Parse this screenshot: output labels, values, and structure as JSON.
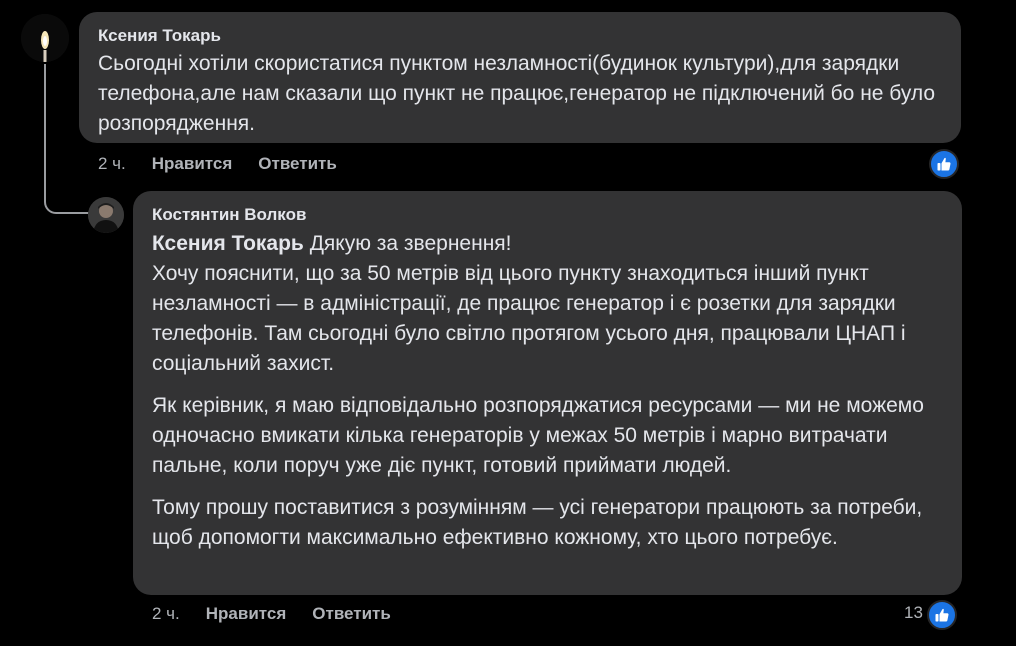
{
  "comments": [
    {
      "author": "Ксения Токарь",
      "text": "Сьогодні хотіли скористатися пунктом незламності(будинок культури),для зарядки телефона,але нам сказали що пункт не працює,генератор не підключений бо не було розпорядження.",
      "time": "2 ч.",
      "like_label": "Нравится",
      "reply_label": "Ответить",
      "reaction_icon": "thumbs-up-icon",
      "avatar_icon": "candle-avatar"
    },
    {
      "author": "Костянтин Волков",
      "mention": "Ксения Токарь",
      "text_intro": "Дякую за звернення!",
      "paragraphs": [
        "Хочу пояснити, що за 50 метрів від цього пункту знаходиться інший пункт незламності — в адміністрації, де працює генератор і є розетки для зарядки телефонів. Там сьогодні було світло протягом усього дня, працювали ЦНАП і соціальний захист.",
        "Як керівник, я маю відповідально розпоряджатися ресурсами — ми не можемо одночасно вмикати кілька генераторів у межах 50 метрів і марно витрачати пальне, коли поруч уже діє пункт, готовий приймати людей.",
        "Тому прошу поставитися з розумінням — усі генератори працюють за потреби, щоб допомогти максимально ефективно кожному, хто цього потребує."
      ],
      "time": "2 ч.",
      "like_label": "Нравится",
      "reply_label": "Ответить",
      "reaction_count": "13",
      "reaction_icon": "thumbs-up-icon",
      "avatar_icon": "person-photo-avatar"
    }
  ],
  "colors": {
    "background": "#000000",
    "bubble": "#333334",
    "text": "#e4e6eb",
    "secondary_text": "#b0b3b8",
    "like_blue": "#1b74e4",
    "thread_line": "#9a9ca0"
  }
}
